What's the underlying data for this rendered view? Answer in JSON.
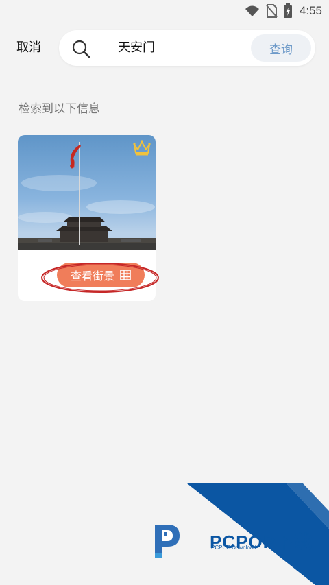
{
  "status_bar": {
    "time": "4:55",
    "icons": [
      "wifi-icon",
      "no-sim-icon",
      "battery-charging-icon"
    ]
  },
  "header": {
    "cancel_label": "取消",
    "search": {
      "icon": "search-icon",
      "value": "天安门"
    },
    "query_label": "查询"
  },
  "results": {
    "label": "检索到以下信息",
    "items": [
      {
        "image": "tiananmen-square-flagpole-photo",
        "badge_icon": "crown-icon",
        "street_view_label": "查看街景",
        "street_view_icon": "grid-icon",
        "highlighted": true
      }
    ]
  },
  "watermark": {
    "text": "PCPOP下载",
    "subtext": "PCPOP Download",
    "colors": {
      "primary": "#0b56a3"
    }
  },
  "colors": {
    "background": "#f3f3f3",
    "accent": "#f07d5a",
    "query_text": "#6e9ac9",
    "highlight": "#c62828"
  }
}
